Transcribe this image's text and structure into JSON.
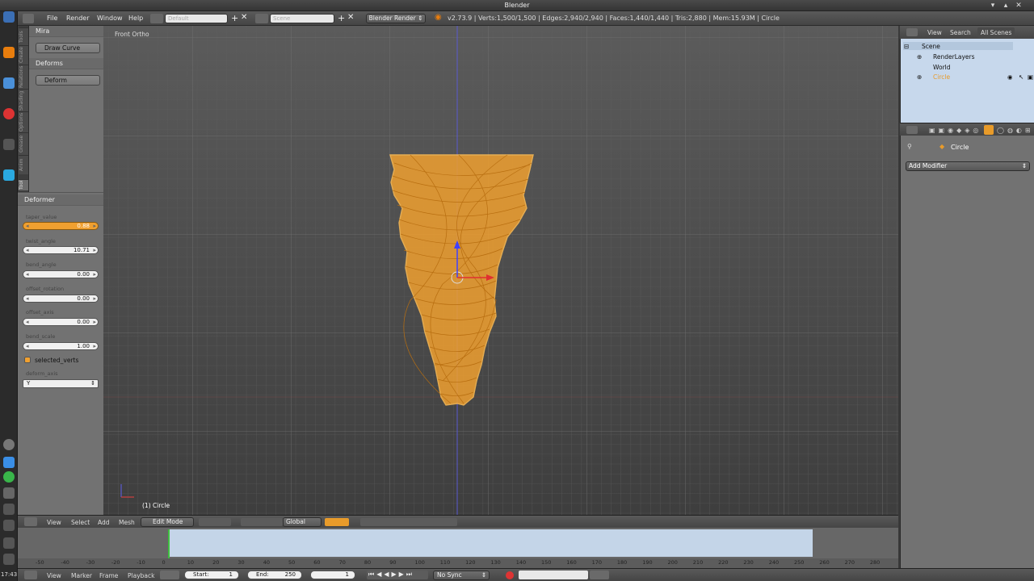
{
  "window": {
    "title": "Blender"
  },
  "header": {
    "menus": [
      "File",
      "Render",
      "Window",
      "Help"
    ],
    "screen_layout": "Default",
    "scene": "Scene",
    "render_engine": "Blender Render",
    "stats": "v2.73.9 | Verts:1,500/1,500 | Edges:2,940/2,940 | Faces:1,440/1,440 | Tris:2,880 | Mem:15.93M | Circle"
  },
  "toolshelf": {
    "tabs": [
      "Tools",
      "Create",
      "Relations",
      "Shading",
      "Options",
      "Grease",
      "Anim",
      "Tool"
    ],
    "panel1_title": "Mira",
    "panel1_button": "Draw Curve",
    "panel2_title": "Deforms",
    "panel2_button": "Deform"
  },
  "operator": {
    "title": "Deformer",
    "props": [
      {
        "label": "taper_value",
        "value": "0.88"
      },
      {
        "label": "twist_angle",
        "value": "10.71"
      },
      {
        "label": "bend_angle",
        "value": "0.00"
      },
      {
        "label": "offset_rotation",
        "value": "0.00"
      },
      {
        "label": "offset_axis",
        "value": "0.00"
      },
      {
        "label": "bend_scale",
        "value": "1.00"
      }
    ],
    "checkbox_label": "selected_verts",
    "checkbox_checked": true,
    "deform_axis_label": "deform_axis",
    "deform_axis_value": "Y"
  },
  "viewport": {
    "view_name": "Front Ortho",
    "object_info": "(1) Circle"
  },
  "outliner": {
    "menus": [
      "View",
      "Search",
      "All Scenes"
    ],
    "items": [
      "Scene",
      "RenderLayers",
      "World",
      "Circle"
    ]
  },
  "properties": {
    "object_name": "Circle",
    "add_modifier": "Add Modifier"
  },
  "view3d_header": {
    "menus": [
      "View",
      "Select",
      "Add",
      "Mesh"
    ],
    "mode": "Edit Mode",
    "orientation": "Global"
  },
  "timeline": {
    "ticks": [
      "-50",
      "-40",
      "-30",
      "-20",
      "-10",
      "0",
      "10",
      "20",
      "30",
      "40",
      "50",
      "60",
      "70",
      "80",
      "90",
      "100",
      "110",
      "120",
      "130",
      "140",
      "150",
      "160",
      "170",
      "180",
      "190",
      "200",
      "210",
      "220",
      "230",
      "240",
      "250",
      "260",
      "270",
      "280"
    ],
    "current_frame_value": 0
  },
  "timeline_header": {
    "menus": [
      "View",
      "Marker",
      "Frame",
      "Playback"
    ],
    "start_label": "Start:",
    "start_value": "1",
    "end_label": "End:",
    "end_value": "250",
    "current": "1",
    "sync": "No Sync"
  },
  "system": {
    "clock": "17:43"
  }
}
